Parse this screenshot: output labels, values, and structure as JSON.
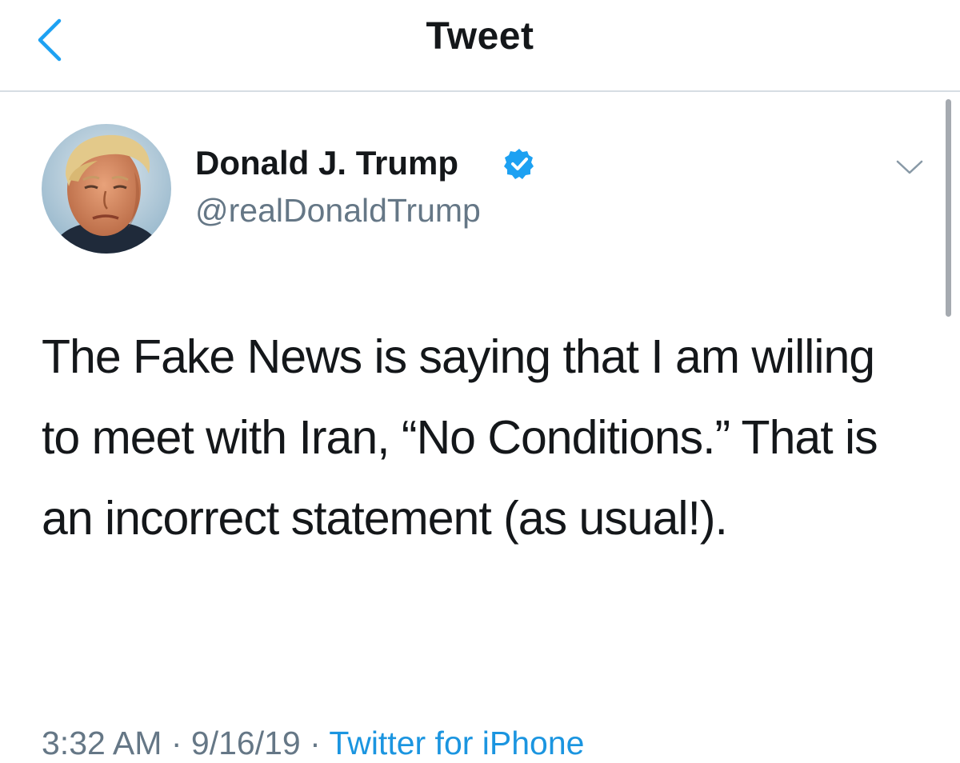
{
  "header": {
    "title": "Tweet",
    "back_icon": "chevron-left-icon"
  },
  "tweet": {
    "author": {
      "display_name": "Donald J. Trump",
      "handle": "@realDonaldTrump",
      "verified_icon": "verified-badge-icon"
    },
    "menu_icon": "chevron-down-icon",
    "text": "The Fake News is saying that I am willing to meet with Iran, “No Conditions.” That is an incorrect statement (as usual!).",
    "time": "3:32 AM",
    "separator": "·",
    "date": "9/16/19",
    "source": "Twitter for iPhone"
  },
  "colors": {
    "accent": "#1da1f2",
    "link": "#1b95e0",
    "secondary_text": "#657786",
    "primary_text": "#14171a",
    "divider": "#d6dde3"
  }
}
